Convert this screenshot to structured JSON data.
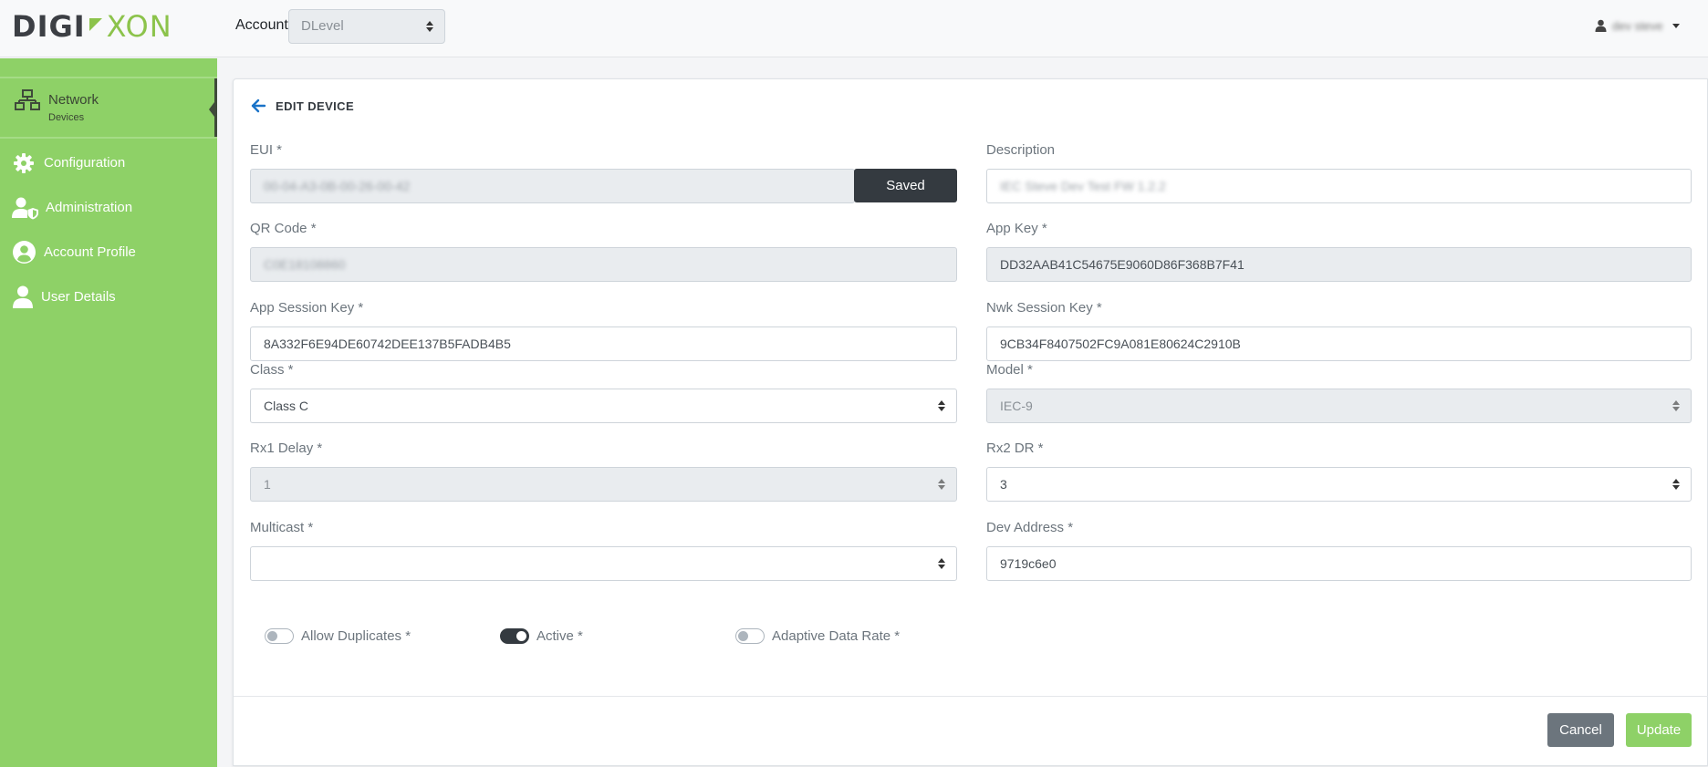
{
  "header": {
    "logo_left": "DIGI",
    "logo_right": "XON",
    "account_label": "Account",
    "account_value": "DLevel",
    "user_name": "dev steve"
  },
  "sidebar": {
    "active": {
      "label": "Network",
      "sublabel": "Devices",
      "icon": "network-icon"
    },
    "items": [
      {
        "label": "Configuration",
        "icon": "gear-icon"
      },
      {
        "label": "Administration",
        "icon": "user-shield-icon"
      },
      {
        "label": "Account Profile",
        "icon": "user-circle-icon"
      },
      {
        "label": "User Details",
        "icon": "user-icon"
      }
    ]
  },
  "page": {
    "title": "EDIT DEVICE"
  },
  "form": {
    "eui": {
      "label": "EUI *",
      "value": "00-04-A3-0B-00-26-00-42",
      "button": "Saved"
    },
    "description": {
      "label": "Description",
      "value": "IEC Steve Dev Test FW 1.2.2"
    },
    "qr_code": {
      "label": "QR Code *",
      "value": "C0E18108860"
    },
    "app_key": {
      "label": "App Key *",
      "value": "DD32AAB41C54675E9060D86F368B7F41"
    },
    "app_session_key": {
      "label": "App Session Key *",
      "value": "8A332F6E94DE60742DEE137B5FADB4B5"
    },
    "nwk_session_key": {
      "label": "Nwk Session Key *",
      "value": "9CB34F8407502FC9A081E80624C2910B"
    },
    "class": {
      "label": "Class *",
      "value": "Class C"
    },
    "model": {
      "label": "Model *",
      "value": "IEC-9"
    },
    "rx1_delay": {
      "label": "Rx1 Delay *",
      "value": "1"
    },
    "rx2_dr": {
      "label": "Rx2 DR *",
      "value": "3"
    },
    "multicast": {
      "label": "Multicast *",
      "value": ""
    },
    "dev_address": {
      "label": "Dev Address *",
      "value": "9719c6e0"
    }
  },
  "toggles": {
    "allow_duplicates": {
      "label": "Allow Duplicates *",
      "on": false
    },
    "active": {
      "label": "Active *",
      "on": true
    },
    "adaptive_data_rate": {
      "label": "Adaptive Data Rate *",
      "on": false
    }
  },
  "footer": {
    "cancel": "Cancel",
    "update": "Update"
  },
  "colors": {
    "brand_green": "#8ed167",
    "dark": "#343a40",
    "cancel_gray": "#6c757d",
    "back_arrow_blue": "#1a73c8"
  }
}
